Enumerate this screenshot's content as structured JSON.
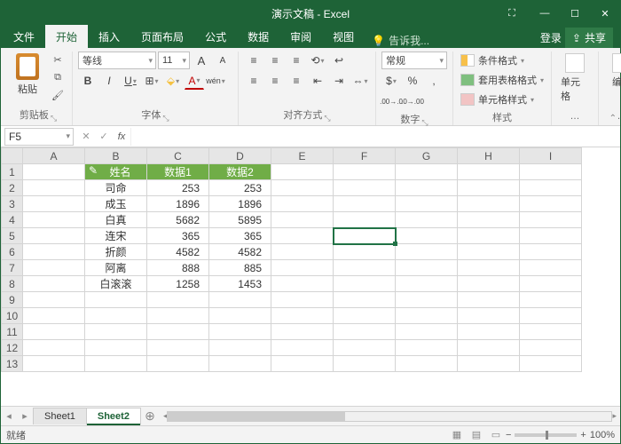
{
  "app": {
    "title": "演示文稿 - Excel"
  },
  "win": {
    "min": "—",
    "max": "☐",
    "close": "✕",
    "extra": "⛶"
  },
  "tabs": {
    "file": "文件",
    "home": "开始",
    "insert": "插入",
    "layout": "页面布局",
    "formulas": "公式",
    "data": "数据",
    "review": "审阅",
    "view": "视图",
    "tellme_icon": "💡",
    "tellme": "告诉我...",
    "login": "登录",
    "share_icon": "⇪",
    "share": "共享"
  },
  "ribbon": {
    "clipboard": {
      "label": "剪贴板",
      "paste": "粘贴",
      "cut": "✂",
      "copy": "⧉",
      "brush": "🖌"
    },
    "font": {
      "label": "字体",
      "name": "等线",
      "size": "11",
      "grow": "A",
      "shrink": "A",
      "bold": "B",
      "italic": "I",
      "underline": "U",
      "border": "⊞",
      "fill": "⬙",
      "color": "A",
      "pinyin": "wén"
    },
    "align": {
      "label": "对齐方式",
      "top": "≡",
      "mid": "≡",
      "bot": "≡",
      "left": "≡",
      "center": "≡",
      "right": "≡",
      "indent_l": "⇤",
      "indent_r": "⇥",
      "wrap": "↩",
      "merge": "⇔"
    },
    "number": {
      "label": "数字",
      "format": "常规",
      "currency": "$",
      "percent": "%",
      "comma": ",",
      "inc": ".00→.0",
      "dec": ".0→.00"
    },
    "styles": {
      "label": "样式",
      "cf": "条件格式",
      "table": "套用表格格式",
      "cell": "单元格样式"
    },
    "cells": {
      "label": "单元格"
    },
    "editing": {
      "label": "编辑"
    },
    "collapse": "⌃"
  },
  "bar": {
    "namebox": "F5",
    "cancel": "✕",
    "enter": "✓",
    "fx": "fx"
  },
  "headers": {
    "cols": [
      "A",
      "B",
      "C",
      "D",
      "E",
      "F",
      "G",
      "H",
      "I"
    ],
    "rows": [
      "1",
      "2",
      "3",
      "4",
      "5",
      "6",
      "7",
      "8",
      "9",
      "10",
      "11",
      "12",
      "13"
    ]
  },
  "table": {
    "h1": "姓名",
    "h2": "数据1",
    "h3": "数据2",
    "paint": "✎",
    "rows": [
      {
        "n": "司命",
        "d1": "253",
        "d2": "253"
      },
      {
        "n": "成玉",
        "d1": "1896",
        "d2": "1896"
      },
      {
        "n": "白真",
        "d1": "5682",
        "d2": "5895"
      },
      {
        "n": "连宋",
        "d1": "365",
        "d2": "365"
      },
      {
        "n": "折颜",
        "d1": "4582",
        "d2": "4582"
      },
      {
        "n": "阿离",
        "d1": "888",
        "d2": "885"
      },
      {
        "n": "白滚滚",
        "d1": "1258",
        "d2": "1453"
      }
    ]
  },
  "sheets": {
    "s1": "Sheet1",
    "s2": "Sheet2",
    "add": "⊕",
    "nav_l": "◂",
    "nav_r": "▸"
  },
  "status": {
    "ready": "就绪",
    "zoom": "100%",
    "minus": "−",
    "plus": "+"
  }
}
